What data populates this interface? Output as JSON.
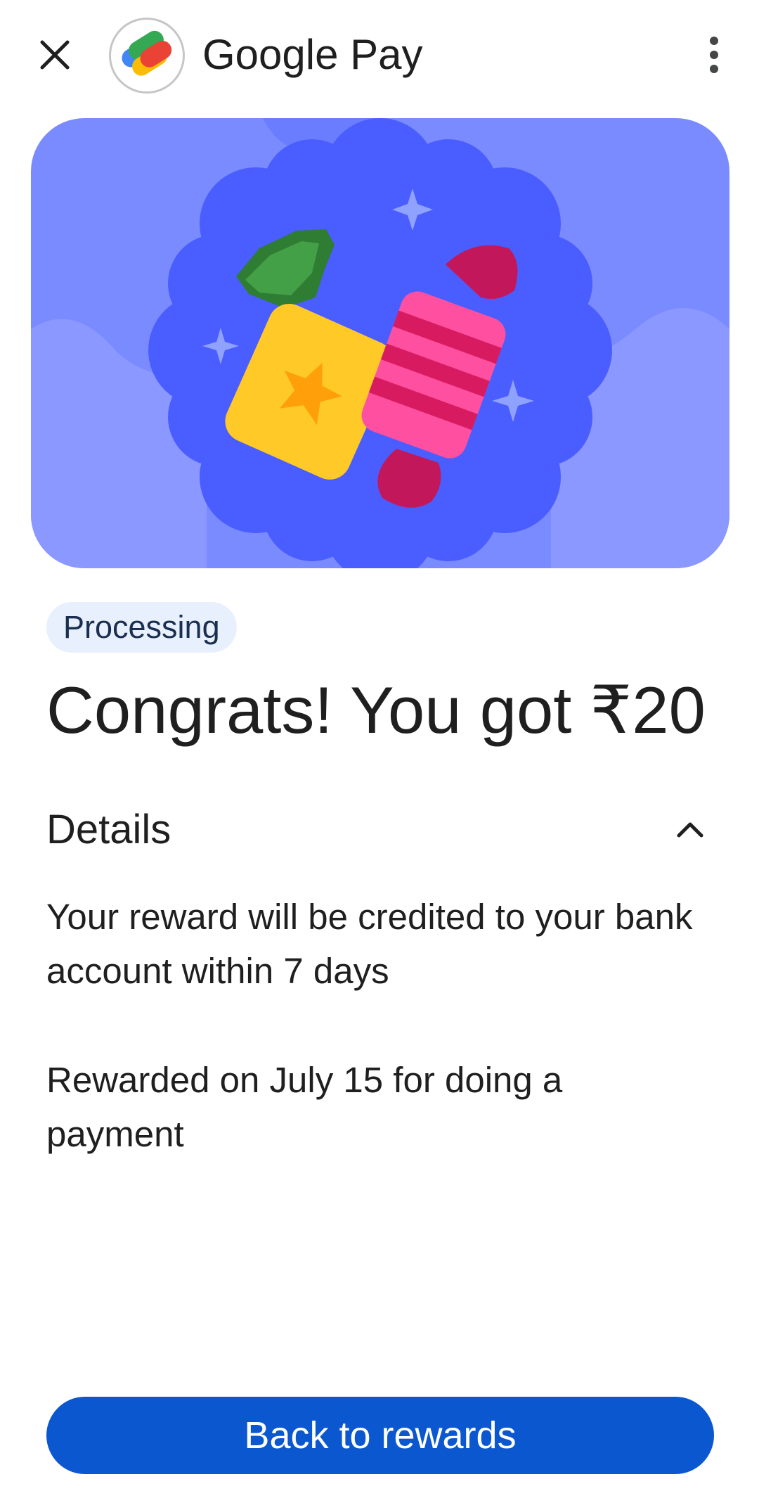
{
  "header": {
    "app_title": "Google Pay",
    "close_icon": "close-icon",
    "more_icon": "more-vert-icon"
  },
  "reward": {
    "status": "Processing",
    "headline": "Congrats! You got ₹20"
  },
  "details": {
    "title": "Details",
    "expanded": true,
    "lines": [
      "Your reward will be credited to your bank account within 7 days",
      "Rewarded on July 15 for doing a payment"
    ]
  },
  "actions": {
    "back_label": "Back to rewards"
  },
  "colors": {
    "accent": "#0b57d0",
    "hero_background": "#7a8bff",
    "hero_scallop": "#4a5dff",
    "chip_background": "#e8f0fe"
  }
}
